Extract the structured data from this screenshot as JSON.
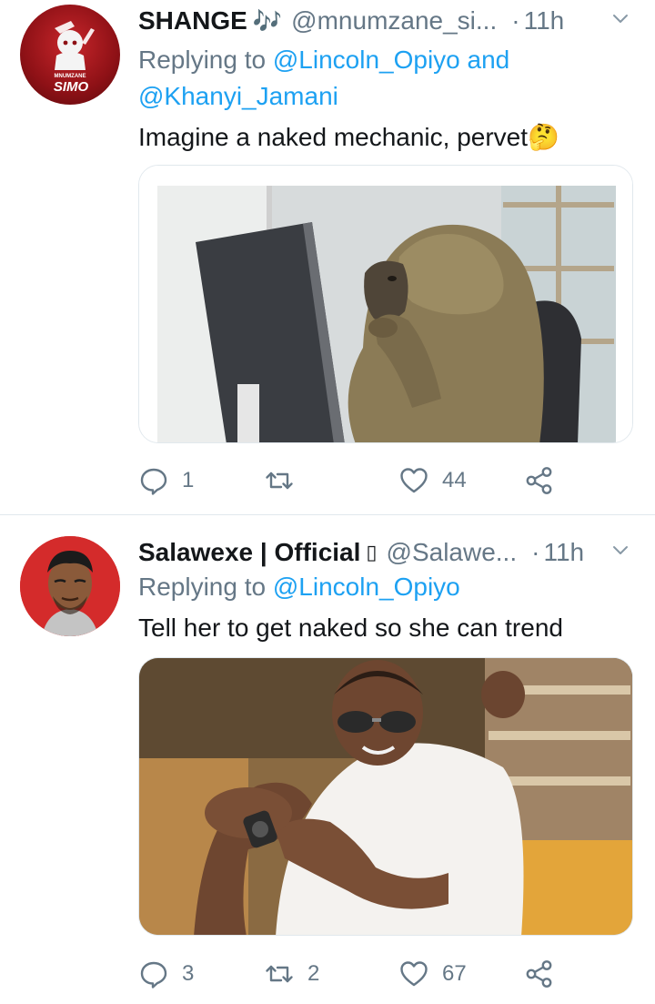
{
  "tweets": [
    {
      "name": "SHANGE",
      "badge": "🎶",
      "handle": "@mnumzane_si...",
      "dot": "·",
      "time": "11h",
      "reply_prefix": "Replying to",
      "reply_to": [
        "@Lincoln_Opiyo",
        "@Khanyi_Jamani"
      ],
      "reply_join": "and",
      "text": "Imagine a naked mechanic, pervet🤔",
      "avatar_text_top": "MNUMZANE",
      "avatar_text_main": "SIMO",
      "counts": {
        "replies": "1",
        "retweets": "",
        "likes": "44"
      }
    },
    {
      "name": "Salawexe | Official",
      "badge": "▯",
      "handle": "@Salawe...",
      "dot": "·",
      "time": "11h",
      "reply_prefix": "Replying to",
      "reply_to": [
        "@Lincoln_Opiyo"
      ],
      "text": "Tell her to get naked so she can trend",
      "counts": {
        "replies": "3",
        "retweets": "2",
        "likes": "67"
      }
    }
  ],
  "icons": {
    "reply": "reply-icon",
    "retweet": "retweet-icon",
    "like": "heart-icon",
    "share": "share-icon",
    "more": "chevron-down-icon"
  },
  "colors": {
    "accent": "#1da1f2",
    "secondary_text": "#657786",
    "primary_text": "#14171a",
    "divider": "#e1e8ed"
  }
}
